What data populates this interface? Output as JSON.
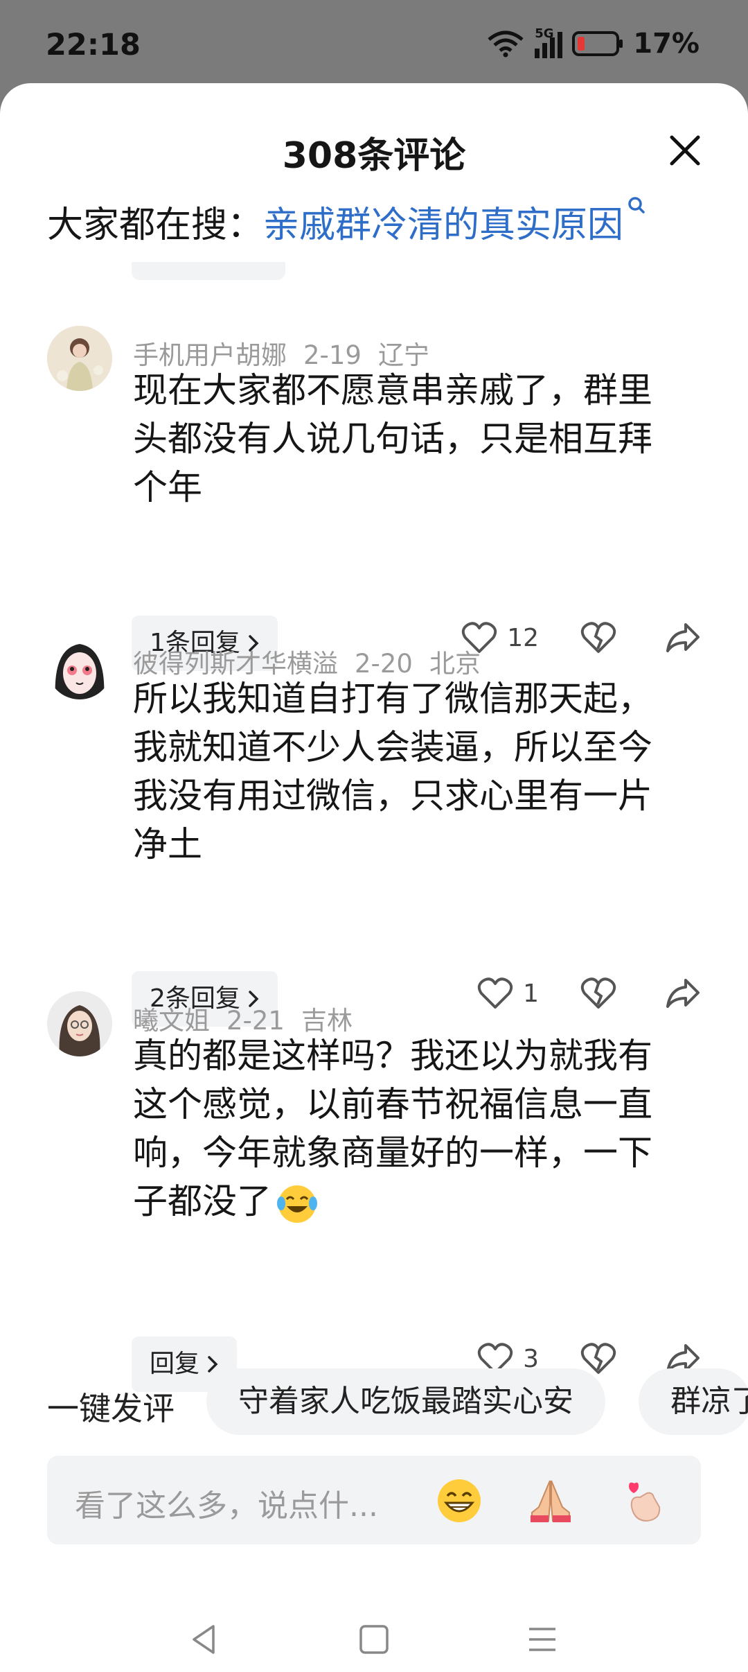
{
  "status_bar": {
    "time": "22:18",
    "network": "5G",
    "battery": "17%"
  },
  "panel": {
    "title": "308条评论",
    "search_prefix": "大家都在搜：",
    "search_keyword": "亲戚群冷清的真实原因"
  },
  "comments": [
    {
      "user": "手机用户胡娜",
      "date": "2-19",
      "location": "辽宁",
      "lines": [
        "现在大家都不愿意串亲戚了，群里",
        "头都没有人说几句话，只是相互拜",
        "个年"
      ],
      "reply_label": "1条回复",
      "likes": "12"
    },
    {
      "user": "彼得列斯才华横溢",
      "date": "2-20",
      "location": "北京",
      "lines": [
        "所以我知道自打有了微信那天起，",
        "我就知道不少人会装逼，所以至今",
        "我没有用过微信，只求心里有一片",
        "净土"
      ],
      "reply_label": "2条回复",
      "likes": "1"
    },
    {
      "user": "曦文姐",
      "date": "2-21",
      "location": "吉林",
      "lines": [
        "真的都是这样吗？我还以为就我有",
        "这个感觉，以前春节祝福信息一直",
        "响，今年就象商量好的一样，一下",
        "子都没了"
      ],
      "reply_label": "回复",
      "likes": "3"
    }
  ],
  "quick_comment": {
    "label": "一键发评",
    "chips": [
      "守着家人吃饭最踏实心安",
      "群凉了"
    ]
  },
  "input": {
    "placeholder": "看了这么多，说点什..."
  },
  "icons": [
    "wifi-icon",
    "signal-icon",
    "battery-icon",
    "close-icon",
    "search-icon",
    "chevron-right-icon",
    "heart-icon",
    "broken-heart-icon",
    "share-icon",
    "grin-emoji",
    "pray-emoji",
    "finger-heart-emoji",
    "back-nav-icon",
    "home-nav-icon",
    "menu-nav-icon"
  ],
  "colors": {
    "accent": "#2e6ec8",
    "battery_low": "#e53935"
  }
}
